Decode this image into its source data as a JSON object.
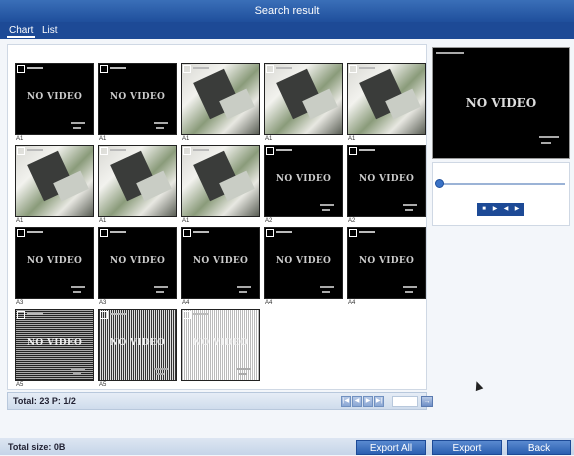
{
  "window": {
    "title": "Search result"
  },
  "tabs": [
    {
      "label": "Chart",
      "active": true
    },
    {
      "label": "List",
      "active": false
    }
  ],
  "thumbnails": [
    {
      "type": "novideo",
      "text": "NO VIDEO",
      "label": "A1"
    },
    {
      "type": "novideo",
      "text": "NO VIDEO",
      "label": "A1"
    },
    {
      "type": "camera",
      "text": "",
      "label": "A1"
    },
    {
      "type": "camera",
      "text": "",
      "label": "A1"
    },
    {
      "type": "camera",
      "text": "",
      "label": "A1"
    },
    {
      "type": "camera",
      "text": "",
      "label": "A1"
    },
    {
      "type": "camera",
      "text": "",
      "label": "A1"
    },
    {
      "type": "camera",
      "text": "",
      "label": "A1"
    },
    {
      "type": "novideo",
      "text": "NO VIDEO",
      "label": "A2"
    },
    {
      "type": "novideo",
      "text": "NO VIDEO",
      "label": "A2"
    },
    {
      "type": "novideo",
      "text": "NO VIDEO",
      "label": "A3"
    },
    {
      "type": "novideo",
      "text": "NO VIDEO",
      "label": "A3"
    },
    {
      "type": "novideo",
      "text": "NO VIDEO",
      "label": "A4"
    },
    {
      "type": "novideo",
      "text": "NO VIDEO",
      "label": "A4"
    },
    {
      "type": "novideo",
      "text": "NO VIDEO",
      "label": "A4"
    },
    {
      "type": "noise",
      "text": "NO VIDEO",
      "label": "A5"
    },
    {
      "type": "noise2",
      "text": "NO VIDEO",
      "label": "A5"
    },
    {
      "type": "noise3",
      "text": "NO VIDEO",
      "label": ""
    }
  ],
  "status": {
    "total": "Total: 23  P: 1/2"
  },
  "pager": {
    "buttons": [
      "|◀",
      "◀",
      "▶",
      "▶|"
    ],
    "go": "→"
  },
  "preview": {
    "text": "NO VIDEO"
  },
  "controls": {
    "buttons": [
      "■",
      "▶",
      "◀",
      "▶"
    ]
  },
  "footer": {
    "total_size": "Total size: 0B",
    "export_all": "Export All",
    "export": "Export",
    "back": "Back"
  },
  "colors": {
    "titlebar": "#2a5fb0",
    "accent": "#1d4a96"
  }
}
